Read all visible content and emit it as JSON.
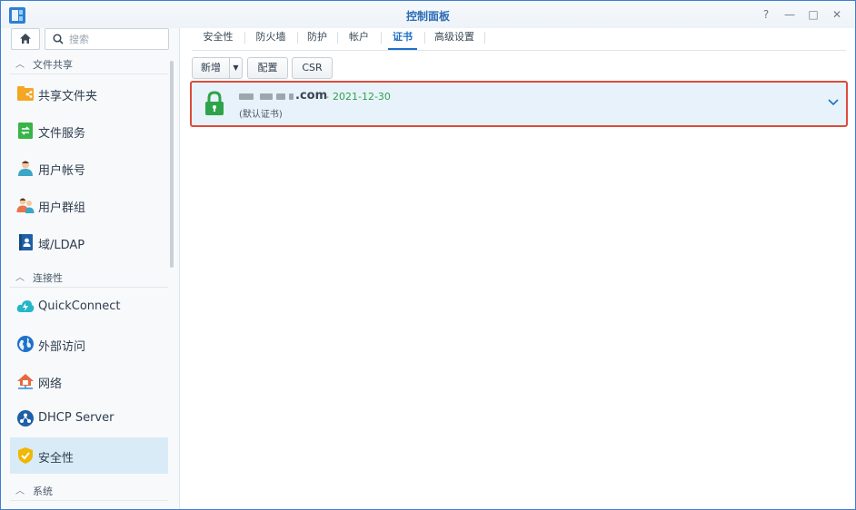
{
  "window": {
    "title": "控制面板",
    "controls": [
      "?",
      "—",
      "□",
      "✕"
    ]
  },
  "sidebar": {
    "search_placeholder": "搜索",
    "sections": [
      {
        "label": "文件共享"
      },
      {
        "label": "连接性"
      },
      {
        "label": "系统"
      }
    ],
    "items": [
      {
        "label": "共享文件夹",
        "icon": "shared-folder-icon"
      },
      {
        "label": "文件服务",
        "icon": "file-services-icon"
      },
      {
        "label": "用户帐号",
        "icon": "user-icon"
      },
      {
        "label": "用户群组",
        "icon": "group-icon"
      },
      {
        "label": "域/LDAP",
        "icon": "domain-ldap-icon"
      },
      {
        "label": "QuickConnect",
        "icon": "quickconnect-icon"
      },
      {
        "label": "外部访问",
        "icon": "globe-icon"
      },
      {
        "label": "网络",
        "icon": "network-icon"
      },
      {
        "label": "DHCP Server",
        "icon": "dhcp-icon"
      },
      {
        "label": "安全性",
        "icon": "security-shield-icon",
        "active": true
      }
    ]
  },
  "tabs": [
    {
      "label": "安全性"
    },
    {
      "label": "防火墙"
    },
    {
      "label": "防护"
    },
    {
      "label": "帐户"
    },
    {
      "label": "证书",
      "active": true
    },
    {
      "label": "高级设置"
    }
  ],
  "toolbar": {
    "add_label": "新增",
    "config_label": "配置",
    "csr_label": "CSR"
  },
  "certificate": {
    "domain_suffix": ".com",
    "separator": "-",
    "expiry": "2021-12-30",
    "default_label": "(默认证书)"
  },
  "colors": {
    "accent": "#1f6fc5",
    "highlight_border": "#e04a3c",
    "valid_green": "#2ea34a",
    "active_bg": "#d9ebf7"
  }
}
